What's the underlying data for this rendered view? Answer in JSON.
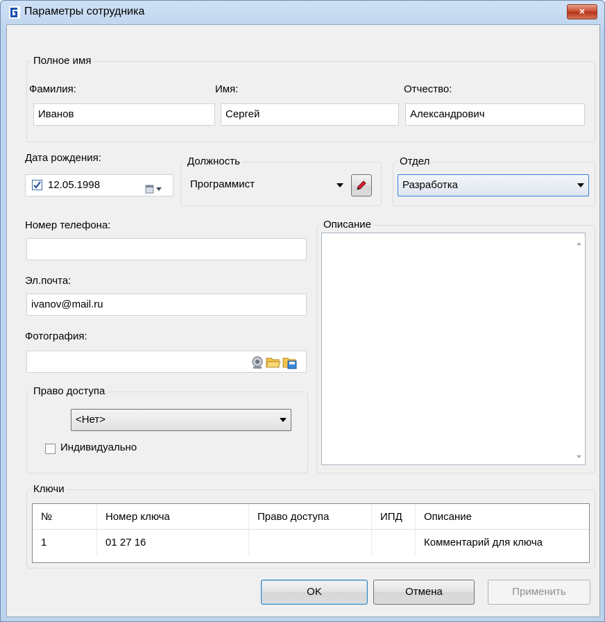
{
  "window": {
    "title": "Параметры сотрудника",
    "close_label": "×"
  },
  "full_name": {
    "group_label": "Полное имя",
    "last_name_label": "Фамилия:",
    "last_name_value": "Иванов",
    "first_name_label": "Имя:",
    "first_name_value": "Сергей",
    "patronymic_label": "Отчество:",
    "patronymic_value": "Александрович"
  },
  "birth_date": {
    "label": "Дата рождения:",
    "value": "12.05.1998",
    "checked": true
  },
  "position": {
    "group_label": "Должность",
    "value": "Программист"
  },
  "department": {
    "group_label": "Отдел",
    "value": "Разработка"
  },
  "phone": {
    "label": "Номер телефона:",
    "value": ""
  },
  "email": {
    "label": "Эл.почта:",
    "value": "ivanov@mail.ru"
  },
  "photo": {
    "label": "Фотография:",
    "value": ""
  },
  "access": {
    "group_label": "Право доступа",
    "value": "<Нет>",
    "individual_label": "Индивидуально",
    "individual_checked": false
  },
  "description": {
    "group_label": "Описание",
    "value": ""
  },
  "keys": {
    "group_label": "Ключи",
    "columns": [
      "№",
      "Номер ключа",
      "Право доступа",
      "ИПД",
      "Описание"
    ],
    "rows": [
      {
        "num": "1",
        "key": "01 27 16",
        "access": "",
        "ipd": "",
        "desc": "Комментарий для ключа"
      }
    ]
  },
  "buttons": {
    "ok": "OK",
    "cancel": "Отмена",
    "apply": "Применить"
  },
  "colors": {
    "selected_combo": "#3b7fd8",
    "title_gradient": "#bcd3ee",
    "close_button": "#c7472b"
  }
}
